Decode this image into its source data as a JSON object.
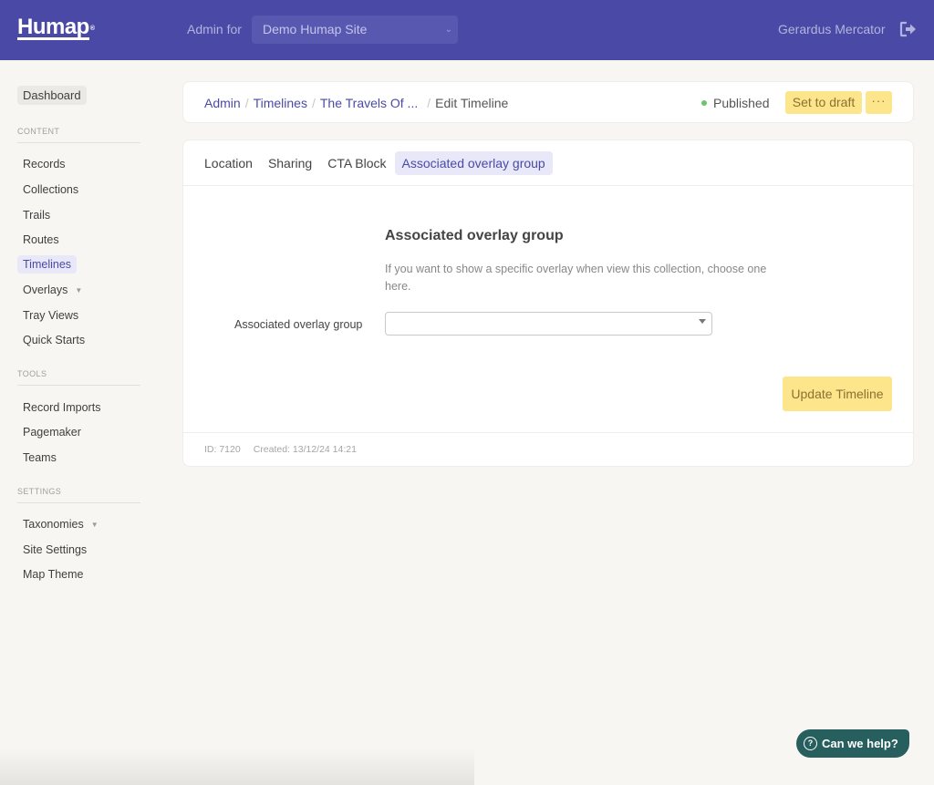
{
  "header": {
    "logo": "Humap",
    "logo_mark": "®",
    "admin_for_label": "Admin for",
    "site_select_value": "Demo Humap Site",
    "user_name": "Gerardus Mercator",
    "logout_icon": "sign-out-icon"
  },
  "sidebar": {
    "dashboard": "Dashboard",
    "sections": [
      {
        "title": "CONTENT",
        "items": [
          {
            "label": "Records"
          },
          {
            "label": "Collections"
          },
          {
            "label": "Trails"
          },
          {
            "label": "Routes"
          },
          {
            "label": "Timelines",
            "active": true
          },
          {
            "label": "Overlays",
            "has_dropdown": true
          },
          {
            "label": "Tray Views"
          },
          {
            "label": "Quick Starts"
          }
        ]
      },
      {
        "title": "TOOLS",
        "items": [
          {
            "label": "Record Imports"
          },
          {
            "label": "Pagemaker"
          },
          {
            "label": "Teams"
          }
        ]
      },
      {
        "title": "SETTINGS",
        "items": [
          {
            "label": "Taxonomies",
            "has_dropdown": true
          },
          {
            "label": "Site Settings"
          },
          {
            "label": "Map Theme"
          }
        ]
      }
    ]
  },
  "breadcrumb": {
    "items": [
      "Admin",
      "Timelines",
      "The Travels Of ..."
    ],
    "current": "Edit Timeline",
    "separator": "/"
  },
  "status": {
    "label": "Published",
    "color": "#6cc46c"
  },
  "actions": {
    "set_to_draft": "Set to draft",
    "more": "···"
  },
  "tabs": [
    {
      "label": "Location"
    },
    {
      "label": "Sharing"
    },
    {
      "label": "CTA Block"
    },
    {
      "label": "Associated overlay group",
      "active": true
    }
  ],
  "form": {
    "section_title": "Associated overlay group",
    "section_help": "If you want to show a specific overlay when view this collection, choose one here.",
    "field_label": "Associated overlay group",
    "field_value": "",
    "submit_label": "Update Timeline"
  },
  "meta": {
    "id": "ID: 7120",
    "created": "Created: 13/12/24 14:21"
  },
  "help": {
    "label": "Can we help?",
    "icon": "?"
  },
  "colors": {
    "brand": "#4a4aa6",
    "accent_yellow": "#fce58a",
    "help_teal": "#275f5e"
  }
}
